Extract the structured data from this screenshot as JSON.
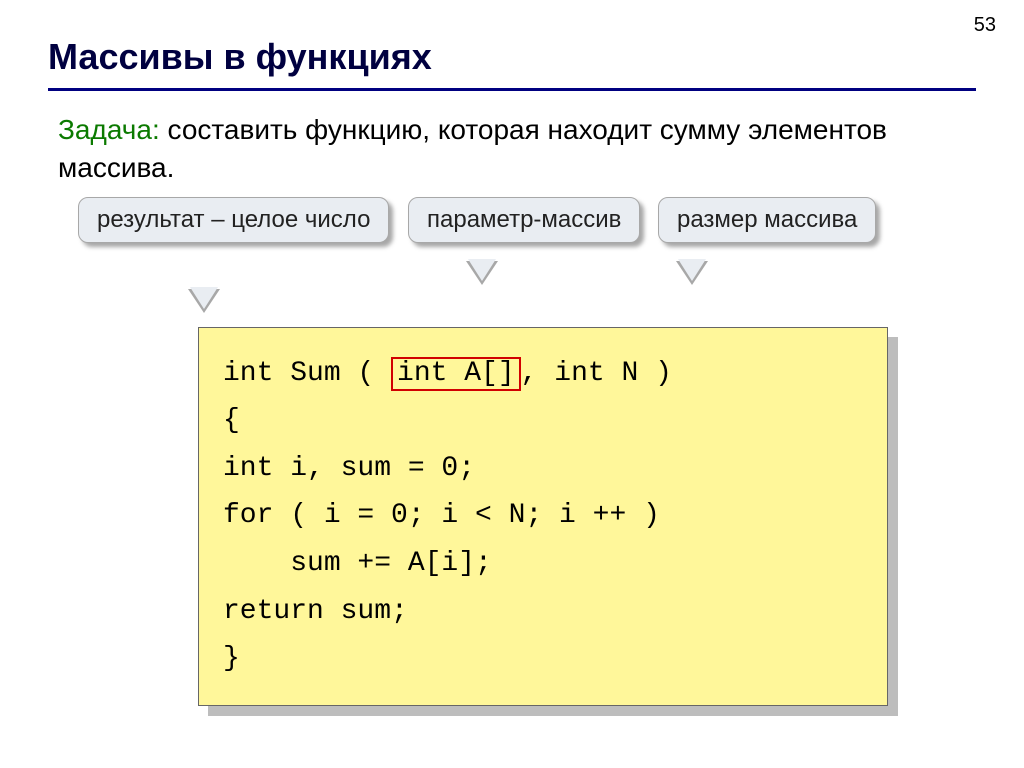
{
  "page_number": "53",
  "title": "Массивы в функциях",
  "task": {
    "label": "Задача:",
    "text": " составить функцию, которая находит сумму элементов массива."
  },
  "callouts": {
    "result": "результат – целое число",
    "param": "параметр-массив",
    "size": "размер массива"
  },
  "code": {
    "line1_a": "int Sum ( ",
    "line1_hl": "int A[]",
    "line1_b": ", int N )",
    "line2": "{",
    "line3": "int i, sum = 0;",
    "line4": "for ( i = 0; i < N; i ++ )",
    "line5": "    sum += A[i];",
    "line6": "return sum;",
    "line7": "}"
  }
}
